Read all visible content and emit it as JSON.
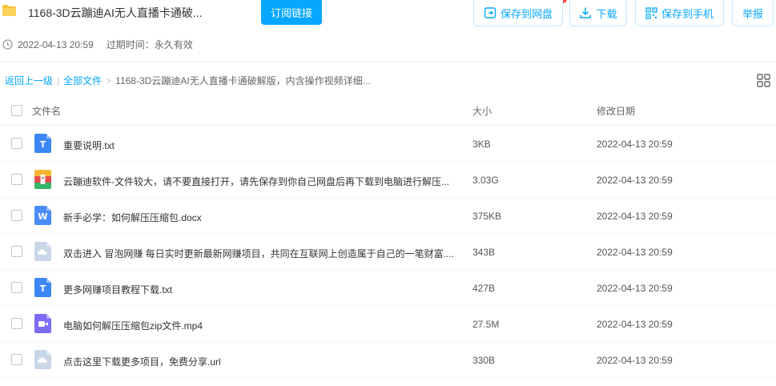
{
  "header": {
    "title": "1168-3D云蹦迪AI无人直播卡通破...",
    "subscribe_label": "订阅链接",
    "save_to_disk_label": "保存到网盘",
    "download_label": "下载",
    "save_to_phone_label": "保存到手机",
    "report_label": "举报",
    "share_date": "2022-04-13 20:59",
    "expire_text": "过期时间：永久有效"
  },
  "breadcrumb": {
    "back_label": "返回上一级",
    "separator": "|",
    "all_files_label": "全部文件",
    "arrow": ">",
    "current": "1168-3D云蹦迪AI无人直播卡通破解版，内含操作视频详细..."
  },
  "table": {
    "columns": [
      "文件名",
      "大小",
      "修改日期"
    ],
    "rows": [
      {
        "name": "重要说明.txt",
        "size": "3KB",
        "date": "2022-04-13 20:59",
        "icon": "txt-file-icon",
        "letter": "T"
      },
      {
        "name": "云蹦迪软件-文件较大，请不要直接打开，请先保存到你自己网盘后再下载到电脑进行解压...",
        "size": "3.03G",
        "date": "2022-04-13 20:59",
        "icon": "archive-file-icon",
        "letter": ""
      },
      {
        "name": "新手必学：如何解压压缩包.docx",
        "size": "375KB",
        "date": "2022-04-13 20:59",
        "icon": "word-file-icon",
        "letter": "W"
      },
      {
        "name": "双击进入 冒泡网赚 每日实时更新最新网赚项目，共同在互联网上创造属于自己的一笔财富....",
        "size": "343B",
        "date": "2022-04-13 20:59",
        "icon": "cloud-file-icon",
        "letter": ""
      },
      {
        "name": "更多网赚项目教程下载.txt",
        "size": "427B",
        "date": "2022-04-13 20:59",
        "icon": "txt-file-icon",
        "letter": "T"
      },
      {
        "name": "电脑如何解压压缩包zip文件.mp4",
        "size": "27.5M",
        "date": "2022-04-13 20:59",
        "icon": "video-file-icon",
        "letter": ""
      },
      {
        "name": "点击这里下载更多项目，免费分享.url",
        "size": "330B",
        "date": "2022-04-13 20:59",
        "icon": "cloud-file-icon",
        "letter": ""
      }
    ]
  },
  "colors": {
    "accent": "#06a7ff",
    "txt_icon": "#3d86f5",
    "word_icon": "#4a8cf7",
    "video_icon": "#7b6cf6",
    "cloud_icon": "#c9d6e8",
    "folder": "#f8c33b"
  }
}
